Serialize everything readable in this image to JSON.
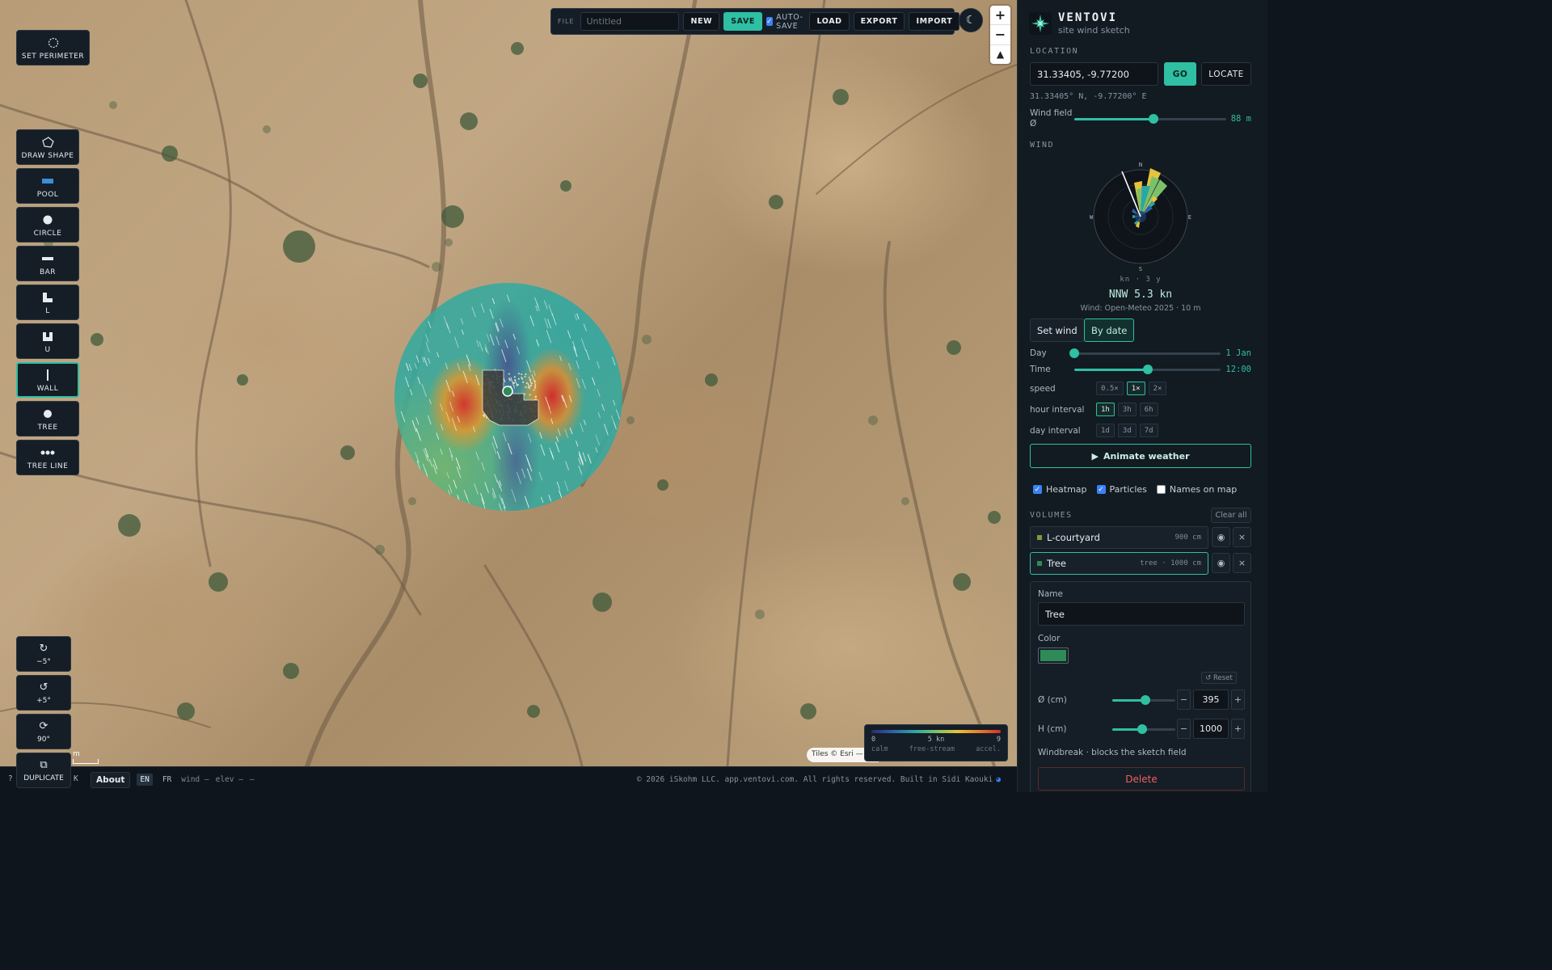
{
  "toolbar_left": {
    "perimeter": "SET PERIMETER",
    "tools": [
      {
        "label": "DRAW SHAPE",
        "icon": "pentagon-outline-icon"
      },
      {
        "label": "POOL",
        "icon": "pool-rect-icon"
      },
      {
        "label": "CIRCLE",
        "icon": "circle-icon"
      },
      {
        "label": "BAR",
        "icon": "bar-icon"
      },
      {
        "label": "L",
        "icon": "l-shape-icon"
      },
      {
        "label": "U",
        "icon": "u-shape-icon"
      },
      {
        "label": "WALL",
        "icon": "wall-icon"
      },
      {
        "label": "TREE",
        "icon": "tree-icon"
      },
      {
        "label": "TREE LINE",
        "icon": "tree-line-icon"
      }
    ],
    "active_tool": "WALL"
  },
  "rotate": {
    "minus5": "−5°",
    "plus5": "+5°",
    "r90": "90°",
    "duplicate": "DUPLICATE"
  },
  "file_bar": {
    "label": "FILE",
    "placeholder": "Untitled",
    "new": "NEW",
    "save": "SAVE",
    "autosave": "AUTO-SAVE",
    "autosave_checked": true,
    "load": "LOAD",
    "export": "EXPORT",
    "import": "IMPORT"
  },
  "map": {
    "attribution": "Tiles © Esri — Es",
    "scale": "m",
    "legend": {
      "low": "0",
      "mid": "5 kn",
      "high": "9",
      "low_label": "calm",
      "mid_label": "free-stream",
      "high_label": "accel."
    }
  },
  "footer": {
    "left_stub": "?",
    "left_k": "K",
    "about": "About",
    "lang_en": "EN",
    "lang_fr": "FR",
    "wind": "wind —",
    "elev": "elev —",
    "dash": "—",
    "copyright": "© 2026 iSkohm LLC. app.ventovi.com. All rights reserved. Built in Sidi Kaouki"
  },
  "panel": {
    "brand": {
      "name": "VENTOVI",
      "sub": "site wind sketch"
    },
    "location": {
      "heading": "LOCATION",
      "value": "31.33405, -9.77200",
      "go": "GO",
      "locate": "LOCATE",
      "coords": "31.33405° N, -9.77200° E"
    },
    "wind_field": {
      "label": "Wind field Ø",
      "value": "88 m",
      "level": 0.52
    },
    "wind": {
      "heading": "WIND",
      "rose": {
        "n": "N",
        "e": "E",
        "s": "S",
        "w": "W",
        "units": "kn · 3 y"
      },
      "reading": "NNW 5.3 kn",
      "source": "Wind: Open-Meteo 2025 · 10 m",
      "set_wind": "Set wind",
      "by_date": "By date",
      "day_label": "Day",
      "day_value": "1 Jan",
      "day_level": 0.0,
      "time_label": "Time",
      "time_value": "12:00",
      "time_level": 0.5,
      "speed_label": "speed",
      "speed_opts": [
        "0.5×",
        "1×",
        "2×"
      ],
      "speed_sel": 1,
      "hour_label": "hour interval",
      "hour_opts": [
        "1h",
        "3h",
        "6h"
      ],
      "hour_sel": 0,
      "dayint_label": "day interval",
      "dayint_opts": [
        "1d",
        "3d",
        "7d"
      ],
      "dayint_sel": -1,
      "animate": "Animate weather"
    },
    "toggles": {
      "heatmap": "Heatmap",
      "heatmap_on": true,
      "particles": "Particles",
      "particles_on": true,
      "names": "Names on map",
      "names_on": false
    },
    "volumes": {
      "heading": "VOLUMES",
      "clear_all": "Clear all",
      "items": [
        {
          "name": "L-courtyard",
          "meta": "900 cm",
          "color": "#7d9b3c"
        },
        {
          "name": "Tree",
          "meta": "tree · 1000 cm",
          "color": "#2e8b57"
        }
      ]
    },
    "editor": {
      "name_label": "Name",
      "name_value": "Tree",
      "color_label": "Color",
      "color": "#2e8b57",
      "reset": "↺ Reset",
      "diam_label": "Ø (cm)",
      "diam_value": "395",
      "diam_level": 0.52,
      "height_label": "H (cm)",
      "height_value": "1000",
      "height_level": 0.48,
      "note": "Windbreak · blocks the sketch field",
      "delete": "Delete"
    }
  },
  "colors": {
    "accent": "#2fbfa3",
    "panel_bg": "#121a22",
    "danger": "#f06060"
  }
}
